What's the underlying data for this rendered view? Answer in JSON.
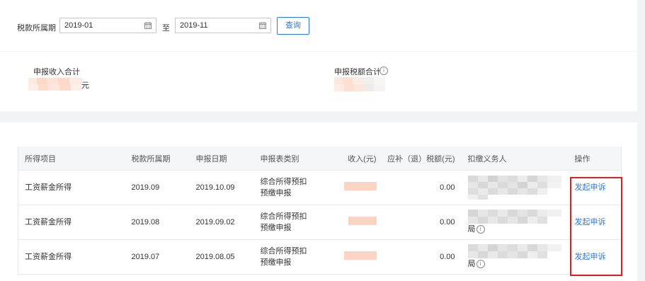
{
  "filter": {
    "period_label": "税款所属期",
    "start_value": "2019-01",
    "to_label": "至",
    "end_value": "2019-11",
    "query_button": "查询"
  },
  "summary": {
    "income_label": "申报收入合计",
    "income_unit": "元",
    "tax_label": "申报税额合计"
  },
  "table": {
    "headers": [
      "所得项目",
      "税款所属期",
      "申报日期",
      "申报表类别",
      "收入(元)",
      "应补（退）税额(元)",
      "扣缴义务人",
      "操作"
    ],
    "rows": [
      {
        "item": "工资薪金所得",
        "period": "2019.09",
        "date": "2019.10.09",
        "category_line1": "综合所得预扣",
        "category_line2": "预缴申报",
        "tax": "0.00",
        "agent_suffix": "",
        "action": "发起申诉"
      },
      {
        "item": "工资薪金所得",
        "period": "2019.08",
        "date": "2019.09.02",
        "category_line1": "综合所得预扣",
        "category_line2": "预缴申报",
        "tax": "0.00",
        "agent_suffix": "局",
        "action": "发起申诉"
      },
      {
        "item": "工资薪金所得",
        "period": "2019.07",
        "date": "2019.08.05",
        "category_line1": "综合所得预扣",
        "category_line2": "预缴申报",
        "tax": "0.00",
        "agent_suffix": "局",
        "action": "发起申诉"
      }
    ]
  }
}
